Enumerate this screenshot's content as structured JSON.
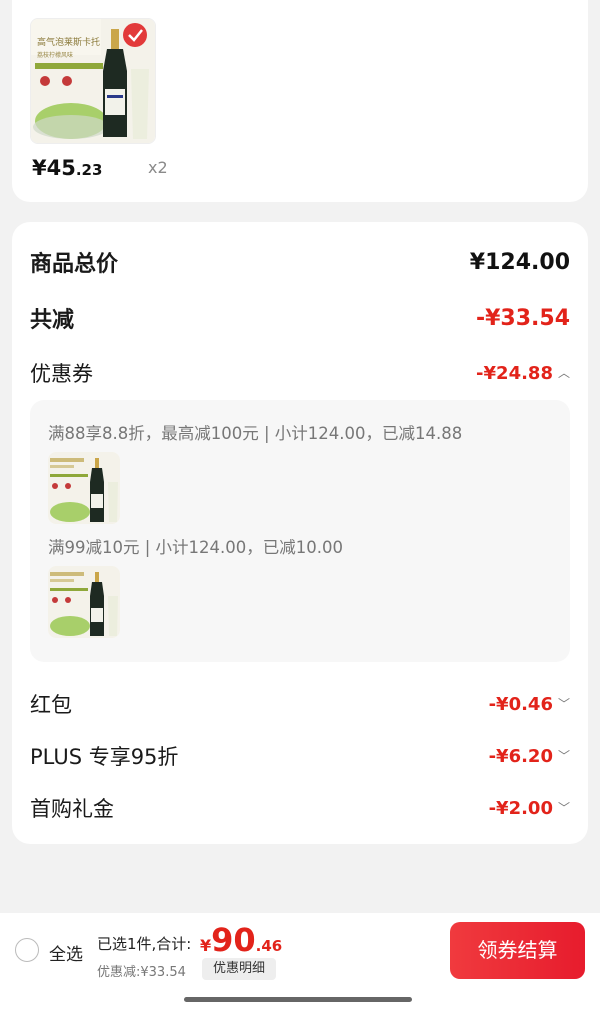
{
  "product": {
    "price_int": "¥45",
    "price_dec": ".23",
    "qty": "x2",
    "image_title": "高气泡莱斯卡托",
    "image_subtitle": "荔枝柠檬风味"
  },
  "summary": {
    "total_label": "商品总价",
    "total_value": "¥124.00",
    "reduce_label": "共减",
    "reduce_value": "-¥33.54",
    "coupon_label": "优惠券",
    "coupon_value": "-¥24.88",
    "coupon_rules": [
      "满88享8.8折，最高减100元 | 小计124.00，已减14.88",
      "满99减10元 | 小计124.00，已减10.00"
    ],
    "redpacket_label": "红包",
    "redpacket_value": "-¥0.46",
    "plus_label": "PLUS 专享95折",
    "plus_value": "-¥6.20",
    "firstbuy_label": "首购礼金",
    "firstbuy_value": "-¥2.00"
  },
  "bottom": {
    "select_all": "全选",
    "selected_text": "已选1件,合计:",
    "total_cur": "¥",
    "total_int": "90",
    "total_dec": ".46",
    "discount_text": "优惠减:¥33.54",
    "discount_detail_btn": "优惠明细",
    "checkout_btn": "领券结算"
  },
  "colors": {
    "accent_red": "#e2231a",
    "checkout_bg": "#ec2b35"
  }
}
